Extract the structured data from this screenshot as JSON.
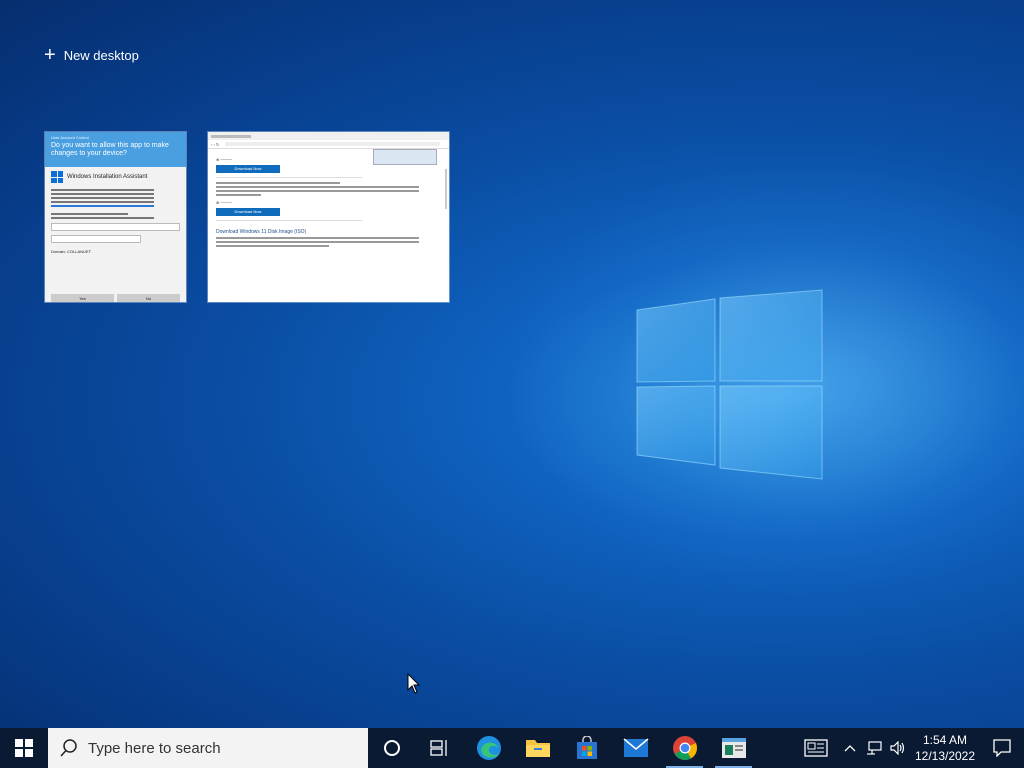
{
  "desktop": {
    "new_desktop_label": "New desktop"
  },
  "task_view": {
    "windows": [
      {
        "id": "uac",
        "title": "User Account Control",
        "question": "Do you want to allow this app to make changes to your device?",
        "app_name": "Windows Installation Assistant",
        "domain_text": "Domain: COLLANUET",
        "yes_label": "Yes",
        "no_label": "No"
      },
      {
        "id": "browser",
        "buttons": [
          "Download Now",
          "Download Now"
        ],
        "heading": "Download Windows 11 Disk Image (ISO)"
      }
    ]
  },
  "taskbar": {
    "search_placeholder": "Type here to search",
    "time": "1:54 AM",
    "date": "12/13/2022",
    "apps": [
      {
        "name": "cortana",
        "active": false
      },
      {
        "name": "task-view",
        "active": false
      },
      {
        "name": "edge",
        "active": false
      },
      {
        "name": "file-explorer",
        "active": false
      },
      {
        "name": "microsoft-store",
        "active": false
      },
      {
        "name": "mail",
        "active": false
      },
      {
        "name": "chrome",
        "active": true
      },
      {
        "name": "installer",
        "active": true
      }
    ]
  },
  "colors": {
    "taskbar_bg": "#0b1a33",
    "accent": "#0f6cbd",
    "uac_header": "#4a9fe0"
  }
}
